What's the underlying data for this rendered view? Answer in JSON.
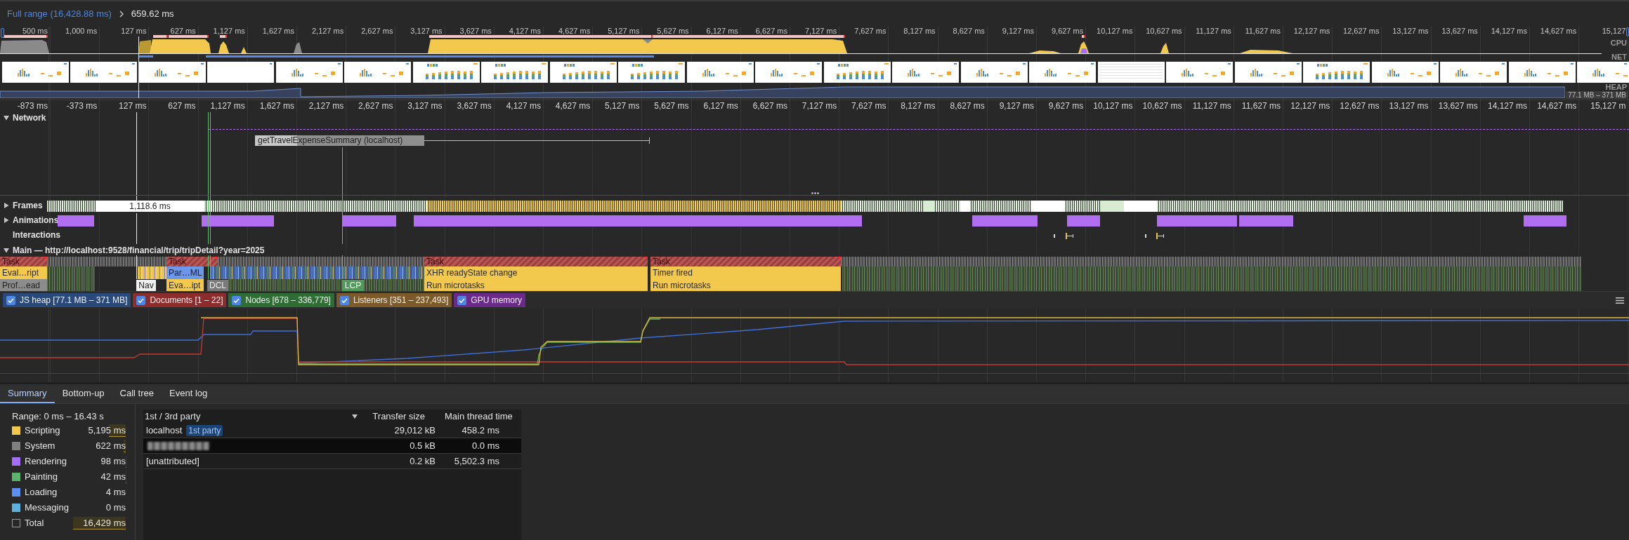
{
  "breadcrumbs": [
    {
      "label": "Full range (16,428.88 ms)",
      "selected": false
    },
    {
      "label": "659.62 ms",
      "selected": true
    }
  ],
  "overview": {
    "ruler": [
      "500 ms",
      "1,000 ms",
      "127 ms",
      "627 ms",
      "1,127 ms",
      "1,627 ms",
      "2,127 ms",
      "2,627 ms",
      "3,127 ms",
      "3,627 ms",
      "4,127 ms",
      "4,627 ms",
      "5,127 ms",
      "5,627 ms",
      "6,127 ms",
      "6,627 ms",
      "7,127 ms",
      "7,627 ms",
      "8,127 ms",
      "8,627 ms",
      "9,127 ms",
      "9,627 ms",
      "10,127 ms",
      "10,627 ms",
      "11,127 ms",
      "11,627 ms",
      "12,127 ms",
      "12,627 ms",
      "13,127 ms",
      "13,627 ms",
      "14,127 ms",
      "14,627 ms",
      "15,127"
    ],
    "lanes": [
      "CPU",
      "NET",
      "HEAP"
    ],
    "heap_range": "77.1 MB – 371 MB"
  },
  "ruler": [
    "-873 ms",
    "-373 ms",
    "127 ms",
    "627 ms",
    "1,127 ms",
    "1,627 ms",
    "2,127 ms",
    "2,627 ms",
    "3,127 ms",
    "3,627 ms",
    "4,127 ms",
    "4,627 ms",
    "5,127 ms",
    "5,627 ms",
    "6,127 ms",
    "6,627 ms",
    "7,127 ms",
    "7,627 ms",
    "8,127 ms",
    "8,627 ms",
    "9,127 ms",
    "9,627 ms",
    "10,127 ms",
    "10,627 ms",
    "11,127 ms",
    "11,627 ms",
    "12,127 ms",
    "12,627 ms",
    "13,127 ms",
    "13,627 ms",
    "14,127 ms",
    "14,627 ms",
    "15,127 m"
  ],
  "tracks": [
    {
      "kind": "network",
      "title": "Network",
      "expanded": true,
      "requests": [
        {
          "label": "getTravelExpenseSummary (localhost)"
        }
      ]
    },
    {
      "kind": "frames",
      "title": "Frames",
      "expanded": false,
      "frame_label": "1,118.6 ms"
    },
    {
      "kind": "animations",
      "title": "Animations",
      "expanded": false
    },
    {
      "kind": "interactions",
      "title": "Interactions"
    },
    {
      "kind": "main",
      "title": "Main — http://localhost:9528/financial/trip/tripDetail?year=2025",
      "expanded": true,
      "rows": [
        [
          {
            "label": "Task",
            "kind": "task"
          },
          {
            "label": "Task",
            "kind": "task"
          },
          {
            "label": "Task",
            "kind": "task"
          },
          {
            "label": "Task",
            "kind": "task"
          }
        ],
        [
          {
            "label": "Eval…ript",
            "kind": "scripting"
          },
          {
            "label": "Par…ML",
            "kind": "loading"
          },
          {
            "label": "XHR readyState change",
            "kind": "scripting"
          },
          {
            "label": "Timer fired",
            "kind": "scripting"
          }
        ],
        [
          {
            "label": "Prof…ead",
            "kind": "system"
          },
          {
            "label": "Eva…ipt",
            "kind": "scripting"
          },
          {
            "label": "Run microtasks",
            "kind": "scripting"
          },
          {
            "label": "Run microtasks",
            "kind": "scripting"
          }
        ]
      ],
      "markers": [
        {
          "label": "Nav",
          "kind": "nav"
        },
        {
          "label": "DCL",
          "kind": "dcl"
        },
        {
          "label": "LCP",
          "kind": "lcp"
        }
      ]
    }
  ],
  "counters": [
    {
      "label": "JS heap [77.1 MB – 371 MB]",
      "checked": true,
      "color": "#2a4a7c"
    },
    {
      "label": "Documents [1 – 22]",
      "checked": true,
      "color": "#8c2c2c"
    },
    {
      "label": "Nodes [678 – 336,779]",
      "checked": true,
      "color": "#2e6e35"
    },
    {
      "label": "Listeners [351 – 237,493]",
      "checked": true,
      "color": "#7d5a2a"
    },
    {
      "label": "GPU memory",
      "checked": true,
      "color": "#6a2a8a"
    }
  ],
  "bottom_tabs": [
    {
      "label": "Summary",
      "selected": true
    },
    {
      "label": "Bottom-up",
      "selected": false
    },
    {
      "label": "Call tree",
      "selected": false
    },
    {
      "label": "Event log",
      "selected": false
    }
  ],
  "summary": {
    "range": "Range: 0 ms – 16.43 s",
    "categories": [
      {
        "name": "Scripting",
        "value": "5,195 ms",
        "color": "#f3c84a",
        "level": 0.316
      },
      {
        "name": "System",
        "value": "622 ms",
        "color": "#808080",
        "level": 0.038
      },
      {
        "name": "Rendering",
        "value": "98 ms",
        "color": "#a56ff5",
        "level": 0.006
      },
      {
        "name": "Painting",
        "value": "42 ms",
        "color": "#5cb36c",
        "level": 0.003
      },
      {
        "name": "Loading",
        "value": "4 ms",
        "color": "#5b8ff2"
      },
      {
        "name": "Messaging",
        "value": "0 ms",
        "color": "#5bb3dd"
      },
      {
        "name": "Total",
        "value": "16,429 ms",
        "kind": "total",
        "level": 1
      }
    ],
    "table": {
      "columns": [
        {
          "label": "1st / 3rd party",
          "sorted": true
        },
        {
          "label": "Transfer size",
          "sorted": false
        },
        {
          "label": "Main thread time",
          "sorted": false
        }
      ],
      "rows": [
        {
          "kind": "entity",
          "name": "localhost",
          "badge": "1st party",
          "transfer_size": "29,012 kB",
          "main_thread_time": "458.2 ms",
          "selected": false
        },
        {
          "kind": "blurred",
          "transfer_size": "0.5 kB",
          "main_thread_time": "0.0 ms",
          "selected": true
        },
        {
          "kind": "entity",
          "name": "[unattributed]",
          "transfer_size": "0.2 kB",
          "main_thread_time": "5,502.3 ms",
          "selected": false
        }
      ]
    }
  }
}
